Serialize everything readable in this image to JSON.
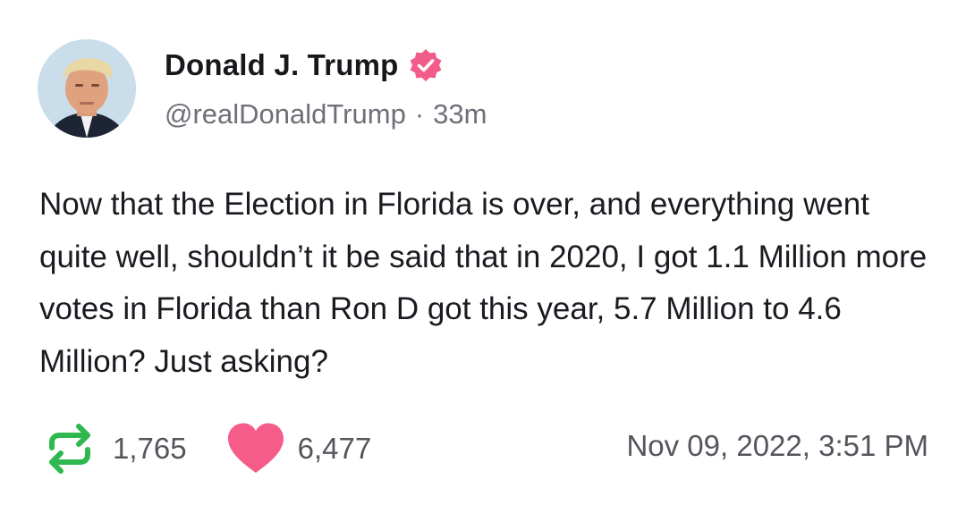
{
  "author": {
    "name": "Donald J. Trump",
    "handle": "@realDonaldTrump",
    "separator": "·",
    "age": "33m",
    "verified_icon": "verified-badge-icon"
  },
  "post": {
    "text": "Now that the Election in Florida is over, and everything went quite well, shouldn’t it be said that in 2020, I got 1.1 Million more votes in Florida than Ron D got this year, 5.7 Million to 4.6 Million? Just asking?"
  },
  "stats": {
    "reposts": "1,765",
    "likes": "6,477",
    "repost_icon": "repost-icon",
    "like_icon": "heart-icon"
  },
  "timestamp": "Nov 09, 2022, 3:51 PM",
  "colors": {
    "verified": "#f25c8b",
    "repost": "#2fb84f",
    "heart": "#f55c8a",
    "text": "#1a1a20",
    "muted": "#6f6f78"
  }
}
